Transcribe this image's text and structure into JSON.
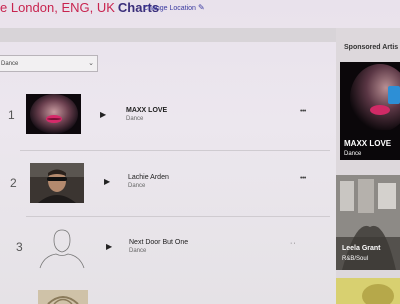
{
  "header": {
    "location": "e London, ENG, UK",
    "charts": "Charts",
    "change_location": "Change Location"
  },
  "genre_filter": {
    "selected": "Dance"
  },
  "sidebar": {
    "heading": "Sponsored Artis",
    "cards": [
      {
        "name": "MAXX LOVE",
        "genre": "Dance"
      },
      {
        "name": "Leela Grant",
        "genre": "R&B/Soul"
      }
    ]
  },
  "chart_rows": [
    {
      "rank": "1",
      "artist": "MAXX LOVE",
      "genre": "Dance"
    },
    {
      "rank": "2",
      "artist": "Lachie Arden",
      "genre": "Dance"
    },
    {
      "rank": "3",
      "artist": "Next Door But One",
      "genre": "Dance"
    }
  ],
  "icons": {
    "edit": "pencil-icon",
    "dropdown": "chevron-down-icon",
    "play": "play-icon",
    "more": "more-options-icon",
    "placeholder": "artist-placeholder-icon"
  },
  "colors": {
    "location_text": "#c8244f",
    "charts_text": "#3a2e7a",
    "link": "#3a3aa0"
  }
}
